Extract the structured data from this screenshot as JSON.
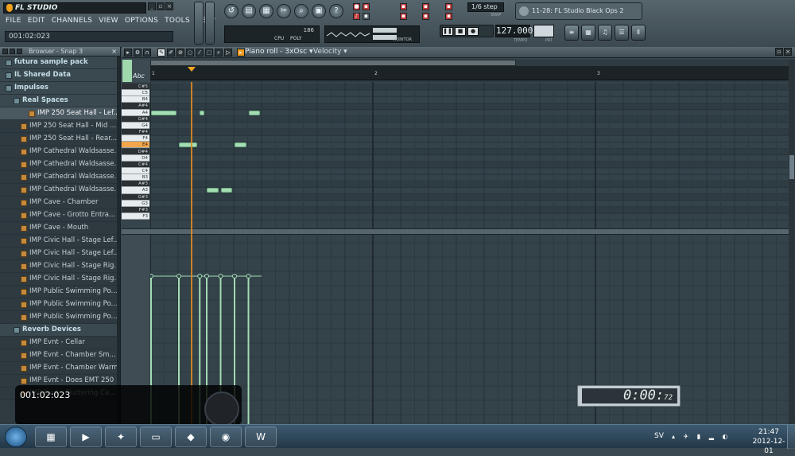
{
  "app": {
    "title": "FL STUDIO",
    "menu": [
      "FILE",
      "EDIT",
      "CHANNELS",
      "VIEW",
      "OPTIONS",
      "TOOLS",
      "HELP"
    ],
    "hint_bar": "001:02:023",
    "step": "1/6 step",
    "step_label": "SNAP",
    "hint_panel": "11-28: FL Studio Black Ops 2",
    "tempo": "127.000",
    "tempo_label": "TEMPO",
    "pat_label": "PAT",
    "scope_number": "186",
    "scope_labels": [
      "CPU",
      "POLY"
    ],
    "wave_label": "MONITOR"
  },
  "browser": {
    "title": "Browser - Snap 3",
    "items": [
      {
        "label": "futura sample pack",
        "type": "folder",
        "indent": 1
      },
      {
        "label": "IL Shared Data",
        "type": "folder",
        "indent": 1
      },
      {
        "label": "Impulses",
        "type": "folder",
        "indent": 1
      },
      {
        "label": "Real Spaces",
        "type": "folder",
        "indent": 2
      },
      {
        "label": "IMP 250 Seat Hall - Lef...",
        "type": "file",
        "indent": 3,
        "selected": true
      },
      {
        "label": "IMP 250 Seat Hall - Mid ...",
        "type": "file",
        "indent": 2
      },
      {
        "label": "IMP 250 Seat Hall - Rear...",
        "type": "file",
        "indent": 2
      },
      {
        "label": "IMP Cathedral Waldsasse...",
        "type": "file",
        "indent": 2
      },
      {
        "label": "IMP Cathedral Waldsasse...",
        "type": "file",
        "indent": 2
      },
      {
        "label": "IMP Cathedral Waldsasse...",
        "type": "file",
        "indent": 2
      },
      {
        "label": "IMP Cathedral Waldsasse...",
        "type": "file",
        "indent": 2
      },
      {
        "label": "IMP Cave - Chamber",
        "type": "file",
        "indent": 2
      },
      {
        "label": "IMP Cave - Grotto Entra...",
        "type": "file",
        "indent": 2
      },
      {
        "label": "IMP Cave - Mouth",
        "type": "file",
        "indent": 2
      },
      {
        "label": "IMP Civic Hall - Stage Lef...",
        "type": "file",
        "indent": 2
      },
      {
        "label": "IMP Civic Hall - Stage Lef...",
        "type": "file",
        "indent": 2
      },
      {
        "label": "IMP Civic Hall - Stage Rig...",
        "type": "file",
        "indent": 2
      },
      {
        "label": "IMP Civic Hall - Stage Rig...",
        "type": "file",
        "indent": 2
      },
      {
        "label": "IMP Public Swimming Po...",
        "type": "file",
        "indent": 2
      },
      {
        "label": "IMP Public Swimming Po...",
        "type": "file",
        "indent": 2
      },
      {
        "label": "IMP Public Swimming Po...",
        "type": "file",
        "indent": 2
      },
      {
        "label": "Reverb Devices",
        "type": "folder",
        "indent": 2
      },
      {
        "label": "IMP Evnt - Cellar",
        "type": "file",
        "indent": 2
      },
      {
        "label": "IMP Evnt - Chamber Sm...",
        "type": "file",
        "indent": 2
      },
      {
        "label": "IMP Evnt - Chamber Warm",
        "type": "file",
        "indent": 2
      },
      {
        "label": "IMP Evnt - Does EMT 250",
        "type": "file",
        "indent": 2
      },
      {
        "label": "IMP Evnt - Fluttering Ca...",
        "type": "file",
        "indent": 2
      }
    ]
  },
  "piano_roll": {
    "title": "Piano roll - 3xOsc",
    "target": "Velocity",
    "bars": [
      "1",
      "2",
      "3"
    ],
    "keys": [
      "C#5",
      "C5",
      "B4",
      "A#4",
      "A4",
      "G#4",
      "G4",
      "F#4",
      "F4",
      "E4",
      "D#4",
      "D4",
      "C#4",
      "C4",
      "B3",
      "A#3",
      "A3",
      "G#3",
      "G3",
      "F#3",
      "F3"
    ],
    "highlighted_key": "E4",
    "notes": [
      {
        "key": "A4",
        "start_beats": 0.0,
        "length_beats": 1.0
      },
      {
        "key": "E4",
        "start_beats": 1.0,
        "length_beats": 0.75
      },
      {
        "key": "A4",
        "start_beats": 1.75,
        "length_beats": 0.25
      },
      {
        "key": "A3",
        "start_beats": 2.0,
        "length_beats": 0.5
      },
      {
        "key": "A3",
        "start_beats": 2.5,
        "length_beats": 0.5
      },
      {
        "key": "E4",
        "start_beats": 3.0,
        "length_beats": 0.5
      },
      {
        "key": "A4",
        "start_beats": 3.5,
        "length_beats": 0.5
      }
    ],
    "playhead_beats": 1.45
  },
  "overlays": {
    "time_readout": "001:02:023",
    "clock_main": "0:00:",
    "clock_small": "72"
  },
  "taskbar": {
    "apps": [
      "calculator-icon",
      "media-player-icon",
      "fl-studio-icon",
      "explorer-icon",
      "app-icon",
      "chrome-icon",
      "word-icon"
    ],
    "lang": "SV",
    "time": "21:47",
    "date": "2012-12-01"
  }
}
